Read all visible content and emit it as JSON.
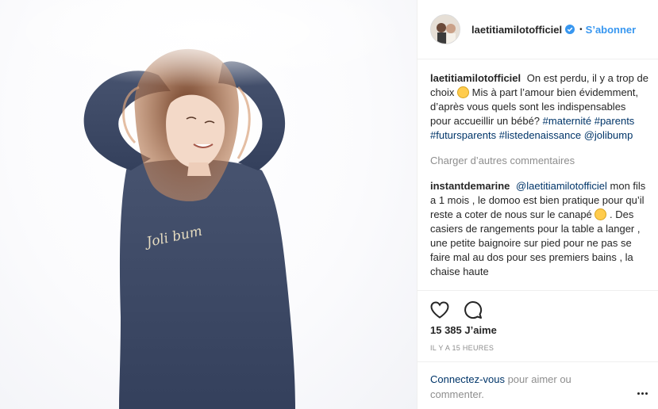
{
  "post": {
    "photo_logo_text": "Joli bum"
  },
  "header": {
    "username": "laetitiamilotofficiel",
    "separator": "•",
    "follow_label": "S’abonner"
  },
  "caption": {
    "user": "laetitiamilotofficiel",
    "text_1": "On est perdu, il y a trop de choix",
    "text_2": "Mis à part l’amour bien évidemment, d’après vous quels sont les indispensables pour accueillir un bébé?",
    "tags": [
      "#maternité",
      "#parents",
      "#futursparents",
      "#listedenaissance",
      "@jolibump"
    ]
  },
  "load_more_label": "Charger d’autres commentaires",
  "comment": {
    "user": "instantdemarine",
    "mention": "@laetitiamilotofficiel",
    "text_1": "mon fils a 1 mois , le domoo est bien pratique pour qu’il reste a coter de nous sur le canapé",
    "text_2": ". Des casiers de rangements pour la table a langer , une petite baignoire sur pied pour ne pas se faire mal au dos pour ses premiers bains , la chaise haute"
  },
  "likes_label": "15 385 J’aime",
  "time_label": "IL Y A 15 HEURES",
  "login": {
    "link_label": "Connectez-vous",
    "rest_label": "pour aimer ou commenter."
  },
  "icons": {
    "like": "heart-icon",
    "comment": "comment-icon",
    "verified": "verified-badge-icon",
    "more": "more-options-icon"
  },
  "colors": {
    "accent": "#3897f0",
    "link": "#003569",
    "muted": "#8e8e8e",
    "sweater": "#3b4863"
  }
}
